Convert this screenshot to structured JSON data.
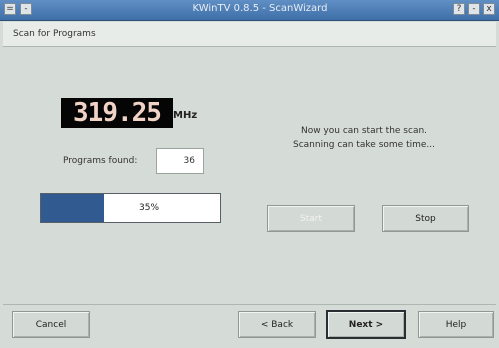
{
  "window": {
    "title": "KWinTV 0.8.5 - ScanWizard"
  },
  "header": {
    "title": "Scan for Programs"
  },
  "frequency": {
    "value": "319.25",
    "unit": "MHz"
  },
  "programs_found": {
    "label": "Programs found:",
    "value": "36"
  },
  "progress": {
    "value": 0.35,
    "label": "35%",
    "fill_color": "#305a90"
  },
  "message": {
    "line1": "Now you can start the scan.",
    "line2": "Scanning can take some time..."
  },
  "scan_buttons": {
    "start_label": "Start",
    "stop_label": "Stop"
  },
  "footer": {
    "cancel_label": "Cancel",
    "back_label": "< Back",
    "next_label": "Next >",
    "help_label": "Help"
  },
  "colors": {
    "accent": "#3f6fa8",
    "window_bg": "#d5dbd6",
    "lcd_text": "#f1d3c6"
  }
}
